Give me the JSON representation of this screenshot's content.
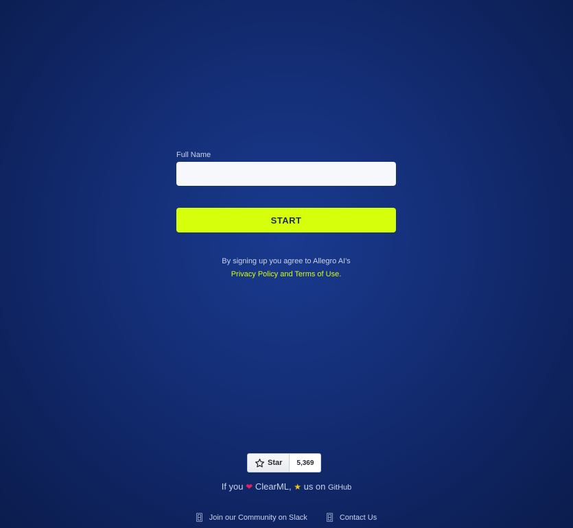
{
  "form": {
    "full_name_label": "Full Name",
    "full_name_value": "",
    "full_name_placeholder": "",
    "start_label": "START"
  },
  "terms": {
    "text": "By signing up you agree to Allegro AI's",
    "link_label": "Privacy Policy and Terms of Use."
  },
  "github": {
    "star_label": "Star",
    "star_count": "5,369",
    "star_icon": "star-outline-icon"
  },
  "love": {
    "prefix": "If you",
    "heart_icon": "heart-icon",
    "middle": "ClearML,",
    "star_icon": "star-emoji-icon",
    "suffix": "us on",
    "link_label": "GitHub"
  },
  "footer": {
    "slack_label": "Join our Community on Slack",
    "contact_label": "Contact Us"
  },
  "colors": {
    "accent": "#d6ff0b",
    "background": "#15307a"
  }
}
